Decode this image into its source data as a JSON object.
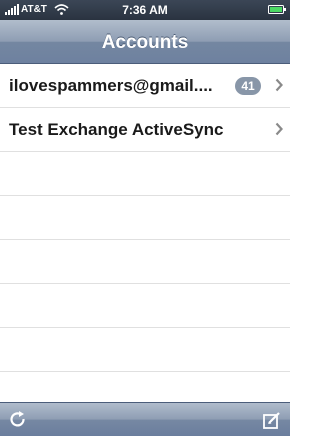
{
  "status_bar": {
    "carrier": "AT&T",
    "time": "7:36 AM",
    "icons": [
      "signal-icon",
      "wifi-icon",
      "battery-icon"
    ]
  },
  "nav": {
    "title": "Accounts"
  },
  "accounts": [
    {
      "label": "ilovespammers@gmail....",
      "badge": "41"
    },
    {
      "label": "Test Exchange ActiveSync",
      "badge": null
    }
  ],
  "toolbar": {
    "icons": [
      "refresh-icon",
      "compose-icon"
    ]
  },
  "colors": {
    "nav_bar": "#8e9db3",
    "badge": "#8896a8",
    "chevron": "#8a8a8a"
  }
}
